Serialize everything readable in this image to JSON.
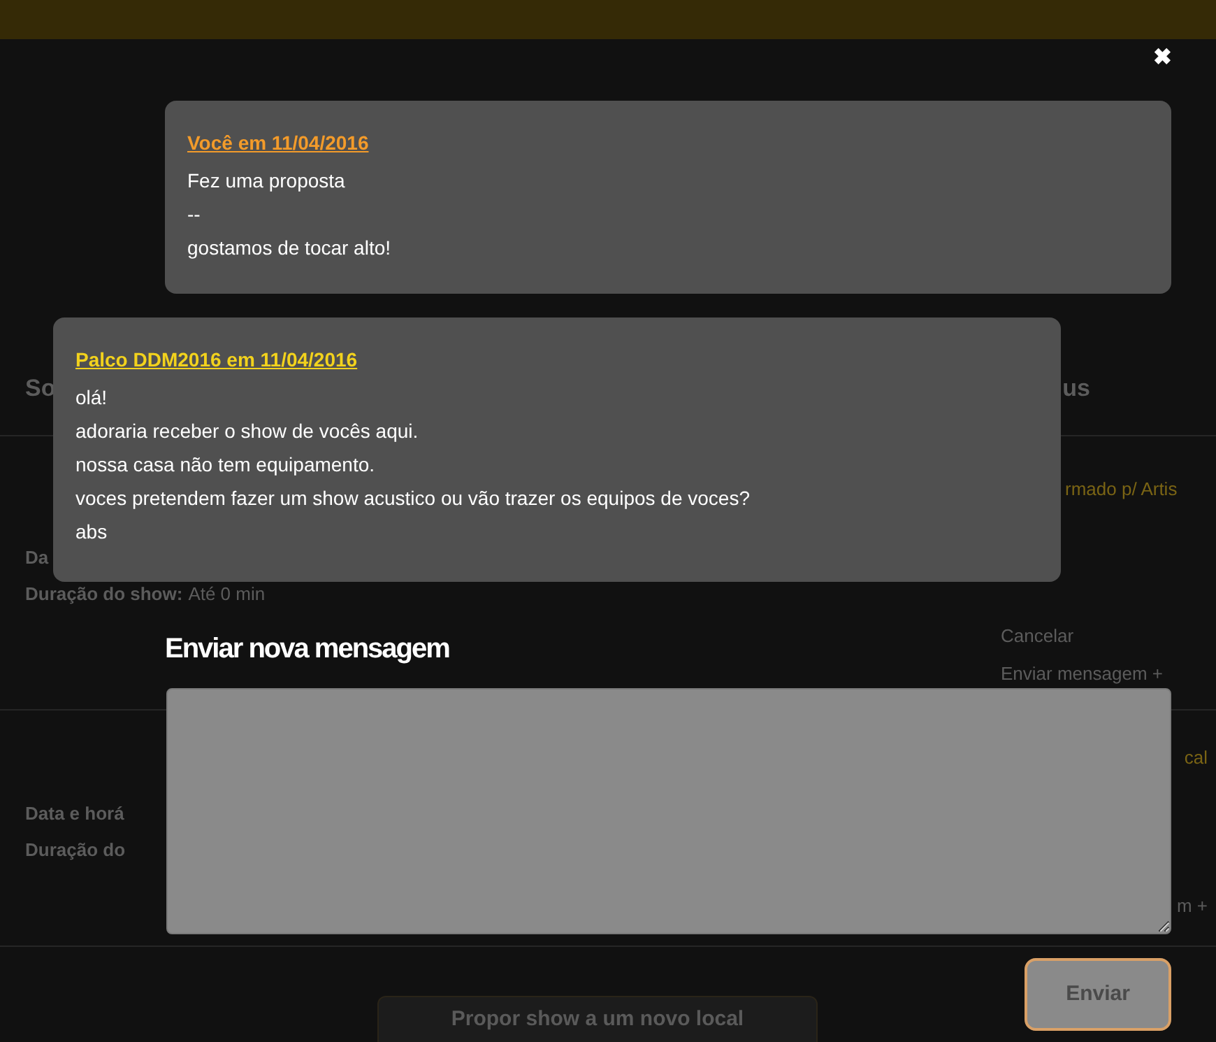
{
  "background": {
    "section_header": {
      "left": "So",
      "right": "us"
    },
    "proposals": [
      {
        "status": "rmado p/ Artis",
        "date_label": "Da",
        "duration_label": "Duração do show:",
        "duration_value": "Até 0 min",
        "actions": [
          "Cancelar",
          "Enviar mensagem +"
        ]
      },
      {
        "status": "cal",
        "date_label": "Data e horá",
        "duration_label": "Duração do",
        "actions": [
          "m +"
        ]
      }
    ],
    "propose_button": "Propor show a um novo local"
  },
  "dialog": {
    "close": "✖",
    "messages": [
      {
        "kind": "own",
        "author": "Você em 11/04/2016",
        "lines": [
          "Fez uma proposta",
          "--",
          "gostamos de tocar alto!"
        ]
      },
      {
        "kind": "other",
        "author": "Palco DDM2016 em 11/04/2016",
        "lines": [
          "olá!",
          "adoraria receber o show de vocês aqui.",
          "nossa casa não tem equipamento.",
          "voces pretendem fazer um show acustico ou vão trazer os equipos de voces?",
          "abs"
        ]
      }
    ],
    "compose": {
      "heading": "Enviar nova mensagem",
      "send_button": "Enviar"
    }
  }
}
